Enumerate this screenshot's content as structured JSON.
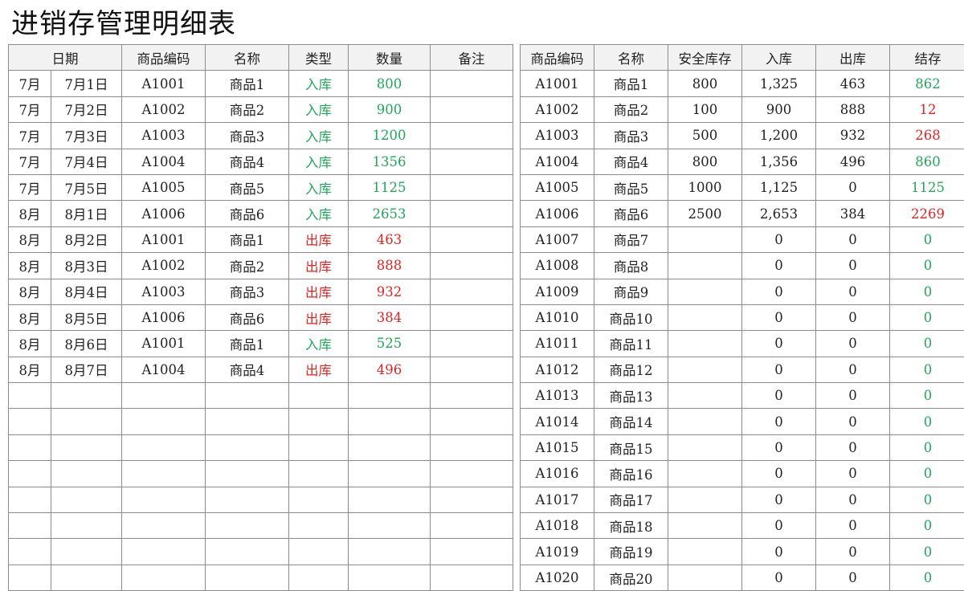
{
  "title": "进销存管理明细表",
  "colors": {
    "in": "#21a65a",
    "out": "#e02424",
    "border": "#8c8c8c",
    "header_bg": "#f2f2f2"
  },
  "detail": {
    "headers": [
      "日期",
      "商品编码",
      "名称",
      "类型",
      "数量",
      "备注"
    ],
    "rows": [
      [
        "7月",
        "7月1日",
        "A1001",
        "商品1",
        "入库",
        "800",
        ""
      ],
      [
        "7月",
        "7月2日",
        "A1002",
        "商品2",
        "入库",
        "900",
        ""
      ],
      [
        "7月",
        "7月3日",
        "A1003",
        "商品3",
        "入库",
        "1200",
        ""
      ],
      [
        "7月",
        "7月4日",
        "A1004",
        "商品4",
        "入库",
        "1356",
        ""
      ],
      [
        "7月",
        "7月5日",
        "A1005",
        "商品5",
        "入库",
        "1125",
        ""
      ],
      [
        "8月",
        "8月1日",
        "A1006",
        "商品6",
        "入库",
        "2653",
        ""
      ],
      [
        "8月",
        "8月2日",
        "A1001",
        "商品1",
        "出库",
        "463",
        ""
      ],
      [
        "8月",
        "8月3日",
        "A1002",
        "商品2",
        "出库",
        "888",
        ""
      ],
      [
        "8月",
        "8月4日",
        "A1003",
        "商品3",
        "出库",
        "932",
        ""
      ],
      [
        "8月",
        "8月5日",
        "A1006",
        "商品6",
        "出库",
        "384",
        ""
      ],
      [
        "8月",
        "8月6日",
        "A1001",
        "商品1",
        "入库",
        "525",
        ""
      ],
      [
        "8月",
        "8月7日",
        "A1004",
        "商品4",
        "出库",
        "496",
        ""
      ],
      [
        "",
        "",
        "",
        "",
        "",
        "",
        ""
      ],
      [
        "",
        "",
        "",
        "",
        "",
        "",
        ""
      ],
      [
        "",
        "",
        "",
        "",
        "",
        "",
        ""
      ],
      [
        "",
        "",
        "",
        "",
        "",
        "",
        ""
      ],
      [
        "",
        "",
        "",
        "",
        "",
        "",
        ""
      ],
      [
        "",
        "",
        "",
        "",
        "",
        "",
        ""
      ],
      [
        "",
        "",
        "",
        "",
        "",
        "",
        ""
      ],
      [
        "",
        "",
        "",
        "",
        "",
        "",
        ""
      ]
    ]
  },
  "summary": {
    "headers": [
      "商品编码",
      "名称",
      "安全库存",
      "入库",
      "出库",
      "结存"
    ],
    "rows": [
      [
        "A1001",
        "商品1",
        "800",
        "1,325",
        "463",
        "862"
      ],
      [
        "A1002",
        "商品2",
        "100",
        "900",
        "888",
        "12"
      ],
      [
        "A1003",
        "商品3",
        "500",
        "1,200",
        "932",
        "268"
      ],
      [
        "A1004",
        "商品4",
        "800",
        "1,356",
        "496",
        "860"
      ],
      [
        "A1005",
        "商品5",
        "1000",
        "1,125",
        "0",
        "1125"
      ],
      [
        "A1006",
        "商品6",
        "2500",
        "2,653",
        "384",
        "2269"
      ],
      [
        "A1007",
        "商品7",
        "",
        "0",
        "0",
        "0"
      ],
      [
        "A1008",
        "商品8",
        "",
        "0",
        "0",
        "0"
      ],
      [
        "A1009",
        "商品9",
        "",
        "0",
        "0",
        "0"
      ],
      [
        "A1010",
        "商品10",
        "",
        "0",
        "0",
        "0"
      ],
      [
        "A1011",
        "商品11",
        "",
        "0",
        "0",
        "0"
      ],
      [
        "A1012",
        "商品12",
        "",
        "0",
        "0",
        "0"
      ],
      [
        "A1013",
        "商品13",
        "",
        "0",
        "0",
        "0"
      ],
      [
        "A1014",
        "商品14",
        "",
        "0",
        "0",
        "0"
      ],
      [
        "A1015",
        "商品15",
        "",
        "0",
        "0",
        "0"
      ],
      [
        "A1016",
        "商品16",
        "",
        "0",
        "0",
        "0"
      ],
      [
        "A1017",
        "商品17",
        "",
        "0",
        "0",
        "0"
      ],
      [
        "A1018",
        "商品18",
        "",
        "0",
        "0",
        "0"
      ],
      [
        "A1019",
        "商品19",
        "",
        "0",
        "0",
        "0"
      ],
      [
        "A1020",
        "商品20",
        "",
        "0",
        "0",
        "0"
      ]
    ]
  }
}
